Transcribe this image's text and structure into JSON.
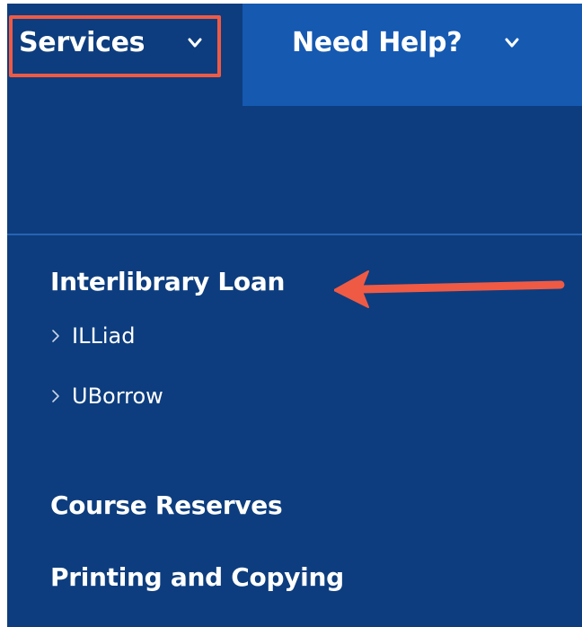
{
  "nav": {
    "services_label": "Services",
    "help_label": "Need Help?"
  },
  "menu": {
    "sections": [
      {
        "heading": "Interlibrary Loan",
        "links": [
          "ILLiad",
          "UBorrow"
        ]
      },
      {
        "heading": "Course Reserves"
      },
      {
        "heading": "Printing and Copying"
      }
    ]
  },
  "annotations": {
    "highlight_color": "#ef5a45",
    "arrow_color": "#ef5a45"
  },
  "colors": {
    "panel_bg": "#0d3d7e",
    "help_tab_bg": "#1559b1",
    "divider": "#2763b5",
    "text": "#ffffff"
  },
  "icons": {
    "nav_chevron": "chevron-down-icon",
    "link_caret": "chevron-right-icon"
  }
}
